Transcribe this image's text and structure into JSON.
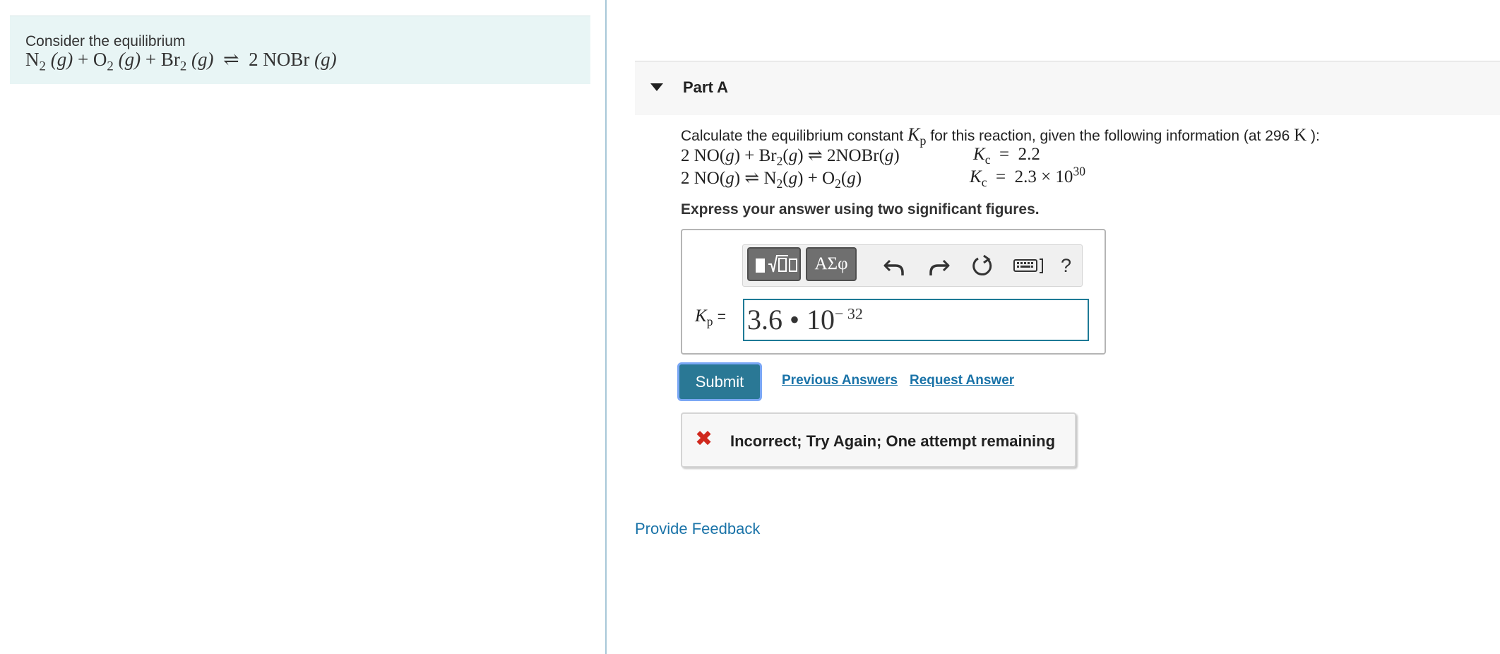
{
  "intro": {
    "text": "Consider the equilibrium",
    "equation": {
      "r1": "N",
      "r1_sub": "2",
      "r1_state": "(g)",
      "r2": "O",
      "r2_sub": "2",
      "r2_state": "(g)",
      "r3": "Br",
      "r3_sub": "2",
      "r3_state": "(g)",
      "plus": "+",
      "arrow": "⇌",
      "product": "2 NOBr",
      "product_state": "(g)"
    }
  },
  "part": {
    "title": "Part A"
  },
  "question": {
    "lead": "Calculate the equilibrium constant",
    "symbol": "K",
    "symbol_sub": "p",
    "tail": "for this reaction, given the following information (at 296",
    "temp_unit": "K",
    "close": "):"
  },
  "reactions": [
    {
      "a": "2 NO(",
      "a_state": "g",
      "a_close": ")",
      "plus": "+",
      "b": "Br",
      "b_sub": "2",
      "b_open": "(",
      "b_state": "g",
      "b_close": ")",
      "arrow": "⇌",
      "c": "2NOBr(",
      "c_state": "g",
      "c_close": ")",
      "k_symbol": "K",
      "k_sub": "c",
      "k_eq": "=",
      "k_value": "2.2"
    },
    {
      "a": "2 NO(",
      "a_state": "g",
      "a_close": ")",
      "arrow": "⇌",
      "b": "N",
      "b_sub": "2",
      "b_open": "(",
      "b_state": "g",
      "b_close": ")",
      "plus": "+",
      "c": "O",
      "c_sub": "2",
      "c_open": "(",
      "c_state": "g",
      "c_close": ")",
      "k_symbol": "K",
      "k_sub": "c",
      "k_eq": "=",
      "k_mantissa": "2.3 × 10",
      "k_exp": "30"
    }
  ],
  "instruction": "Express your answer using two significant figures.",
  "toolbar": {
    "greek_label": "ΑΣφ",
    "help_label": "?",
    "icons": [
      "templates-icon",
      "undo-icon",
      "redo-icon",
      "reset-icon",
      "keyboard-icon",
      "help-icon"
    ]
  },
  "answer": {
    "label_symbol": "K",
    "label_sub": "p",
    "label_eq": "=",
    "mantissa": "3.6",
    "times": "•",
    "base": "10",
    "exponent": "− 32"
  },
  "actions": {
    "submit": "Submit",
    "previous": "Previous Answers",
    "request": "Request Answer"
  },
  "feedback": {
    "icon": "✖",
    "text": "Incorrect; Try Again; One attempt remaining"
  },
  "footer": {
    "provide_feedback": "Provide Feedback"
  },
  "colors": {
    "intro_bg": "#e8f5f5",
    "link": "#1a73a8",
    "submit_bg": "#2a7895",
    "input_border": "#1e7a96",
    "error": "#d0281d"
  }
}
